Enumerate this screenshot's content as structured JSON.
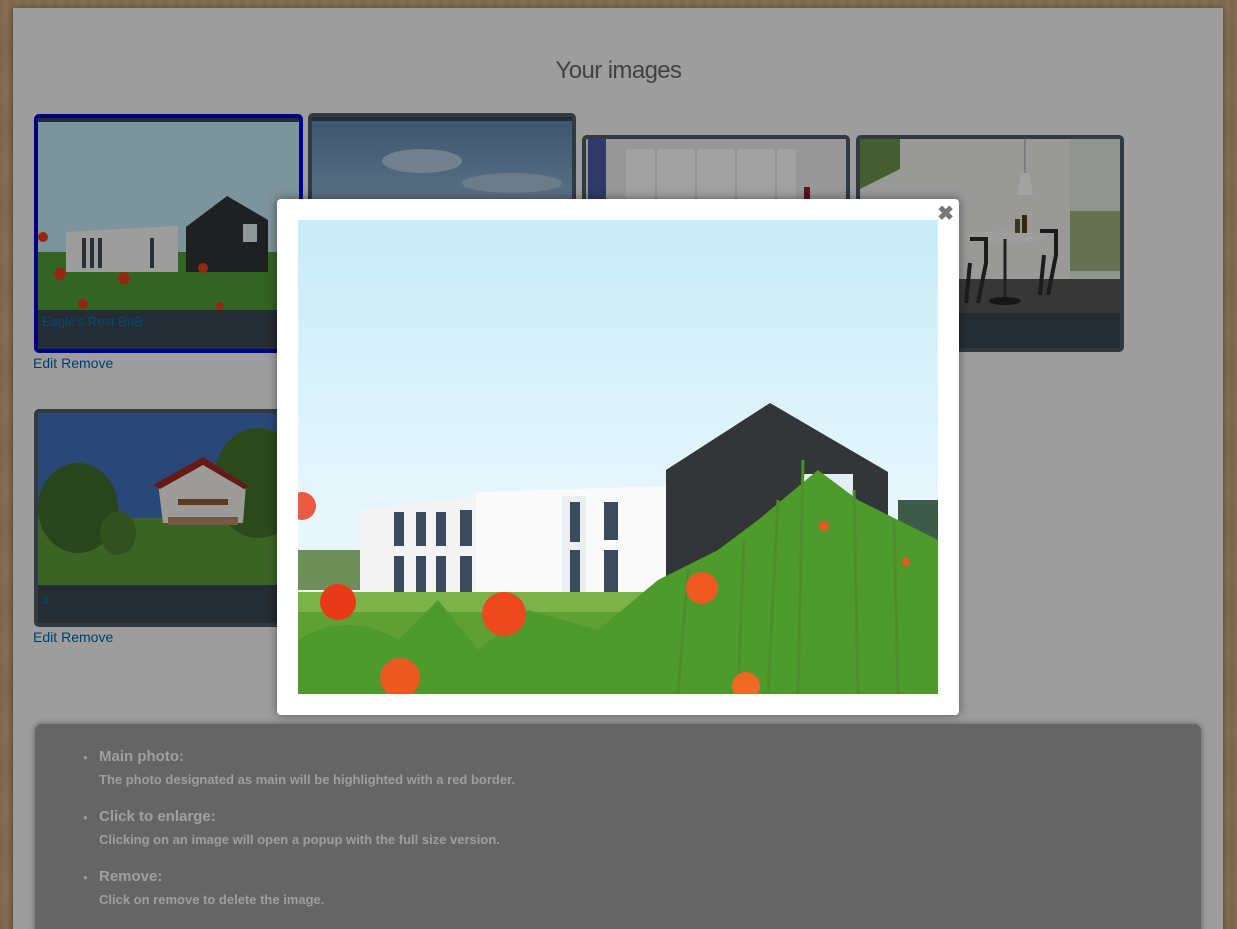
{
  "page": {
    "title": "Your images"
  },
  "images": [
    {
      "caption": "Eagle's Rest BnB",
      "is_main": true,
      "edit_label": "Edit",
      "remove_label": "Remove"
    },
    {
      "caption": "",
      "is_main": false
    },
    {
      "caption": "",
      "is_main": false
    },
    {
      "caption": "",
      "is_main": false
    },
    {
      "caption": "4",
      "is_main": false,
      "edit_label": "Edit",
      "remove_label": "Remove"
    }
  ],
  "modal": {
    "close_glyph": "✖"
  },
  "info": {
    "items": [
      {
        "title": "Main photo:",
        "text": "The photo designated as main will be highlighted with a red border."
      },
      {
        "title": "Click to enlarge:",
        "text": "Clicking on an image will open a popup with the full size version."
      },
      {
        "title": "Remove:",
        "text": "Click on remove to delete the image."
      }
    ],
    "bullet": "•"
  },
  "colors": {
    "main_border": "#0000c8",
    "link": "#0060a0",
    "card_bg": "#3a4650"
  }
}
